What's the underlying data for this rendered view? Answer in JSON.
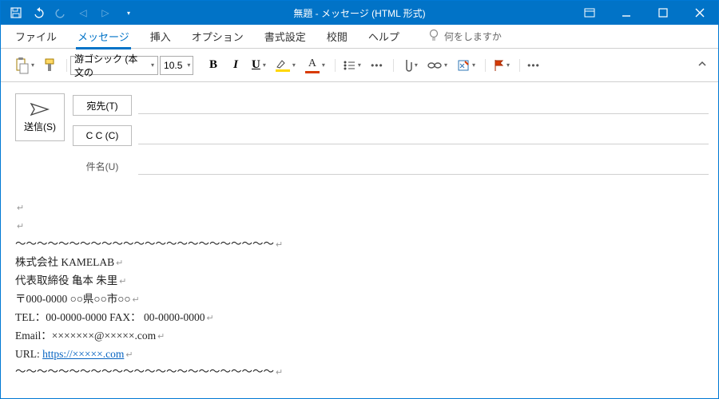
{
  "titlebar": {
    "title": "無題  -  メッセージ (HTML 形式)"
  },
  "menubar": {
    "tabs": [
      "ファイル",
      "メッセージ",
      "挿入",
      "オプション",
      "書式設定",
      "校閲",
      "ヘルプ"
    ],
    "active_index": 1,
    "tell_me": "何をしますか"
  },
  "ribbon": {
    "font_name": "游ゴシック (本文の",
    "font_size": "10.5"
  },
  "compose": {
    "send": "送信(S)",
    "to_btn": "宛先(T)",
    "cc_btn": "C C (C)",
    "subject_label": "件名(U)"
  },
  "body": {
    "wave_top": "～～～～～～～～～～～～～～～～～～～～～～～～",
    "company": "株式会社  KAMELAB",
    "name": "代表取締役  亀本  朱里",
    "address": "〒000-0000  ○○県○○市○○",
    "tel": "TEL：00-0000-0000 FAX：  00-0000-0000",
    "email": "Email：×××××××@×××××.com",
    "url_label": "URL: ",
    "url": "https://×××××.com",
    "wave_bottom": "～～～～～～～～～～～～～～～～～～～～～～～～"
  }
}
